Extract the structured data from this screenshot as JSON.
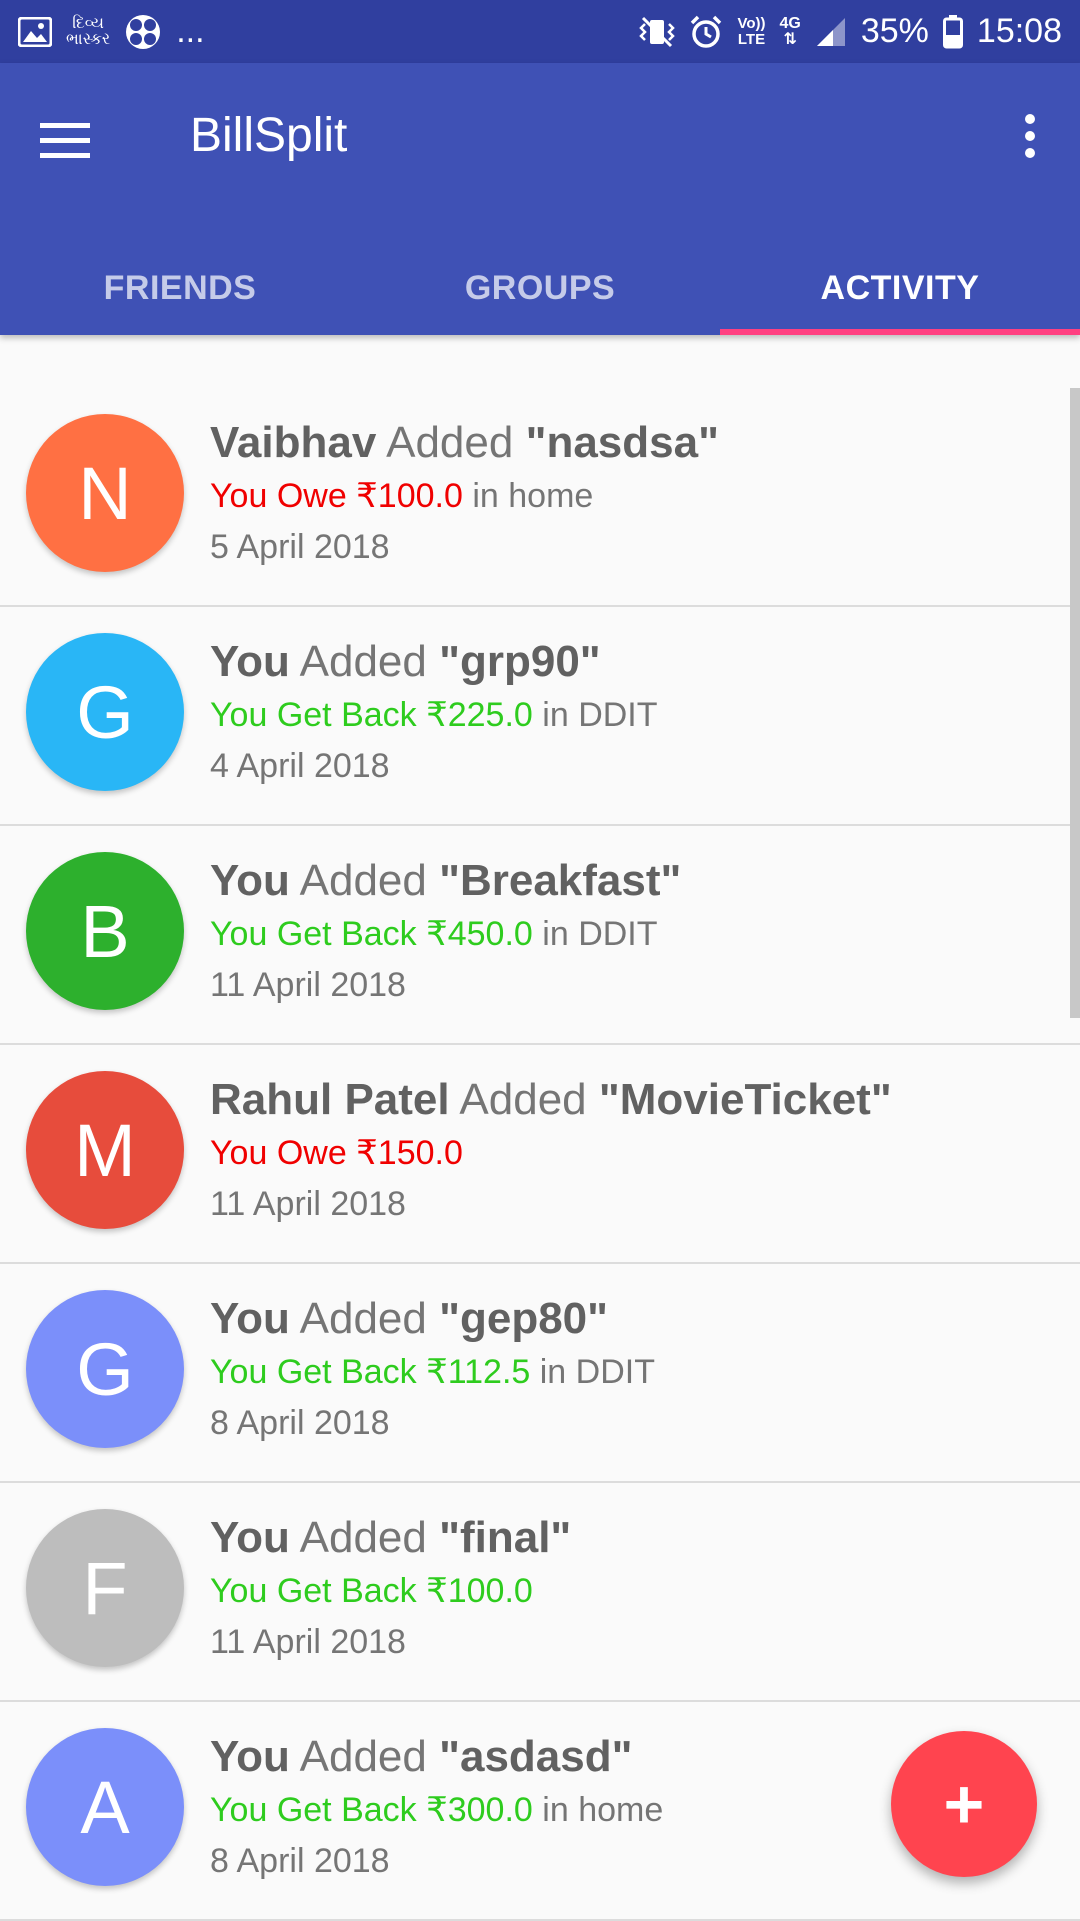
{
  "status_bar": {
    "left_icons": [
      "image-icon",
      "news-app-icon",
      "fan-icon"
    ],
    "news_label_line1": "દિવ્ય",
    "news_label_line2": "ભાસ્કર",
    "ellipsis": "...",
    "right_icons": [
      "mute-vibrate-icon",
      "alarm-icon",
      "volte-icon",
      "network-4g-icon",
      "signal-icon",
      "battery-icon"
    ],
    "volte_line1": "Vo))",
    "volte_line2": "LTE",
    "net_label": "4G",
    "battery": "35%",
    "time": "15:08"
  },
  "app_bar": {
    "title": "BillSplit",
    "tabs": [
      {
        "label": "FRIENDS",
        "active": false
      },
      {
        "label": "GROUPS",
        "active": false
      },
      {
        "label": "ACTIVITY",
        "active": true
      }
    ],
    "accent_color": "#ff4081"
  },
  "activities": [
    {
      "initial": "N",
      "avatar_color": "#ff7043",
      "actor": "Vaibhav",
      "verb": "Added",
      "item": "\"nasdsa\"",
      "amount_text": "You Owe ₹100.0",
      "amount_type": "owe",
      "context": "in home",
      "date": "5 April 2018"
    },
    {
      "initial": "G",
      "avatar_color": "#29b6f6",
      "actor": "You",
      "verb": "Added",
      "item": "\"grp90\"",
      "amount_text": "You Get Back ₹225.0",
      "amount_type": "back",
      "context": "in DDIT",
      "date": "4 April 2018"
    },
    {
      "initial": "B",
      "avatar_color": "#2db02d",
      "actor": "You",
      "verb": "Added",
      "item": "\"Breakfast\"",
      "amount_text": "You Get Back ₹450.0",
      "amount_type": "back",
      "context": "in DDIT",
      "date": "11 April 2018"
    },
    {
      "initial": "M",
      "avatar_color": "#e74c3c",
      "actor": "Rahul Patel",
      "verb": "Added",
      "item": "\"MovieTicket\"",
      "amount_text": "You Owe ₹150.0",
      "amount_type": "owe",
      "context": "",
      "date": "11 April 2018"
    },
    {
      "initial": "G",
      "avatar_color": "#7b8ffa",
      "actor": "You",
      "verb": "Added",
      "item": "\"gep80\"",
      "amount_text": "You Get Back ₹112.5",
      "amount_type": "back",
      "context": "in DDIT",
      "date": "8 April 2018"
    },
    {
      "initial": "F",
      "avatar_color": "#bdbdbd",
      "actor": "You",
      "verb": "Added",
      "item": "\"final\"",
      "amount_text": "You Get Back ₹100.0",
      "amount_type": "back",
      "context": "",
      "date": "11 April 2018"
    },
    {
      "initial": "A",
      "avatar_color": "#7b8ffa",
      "actor": "You",
      "verb": "Added",
      "item": "\"asdasd\"",
      "amount_text": "You Get Back ₹300.0",
      "amount_type": "back",
      "context": "in home",
      "date": "8 April 2018"
    }
  ],
  "fab": {
    "symbol": "+",
    "icon": "add-icon",
    "color": "#ff444f"
  }
}
